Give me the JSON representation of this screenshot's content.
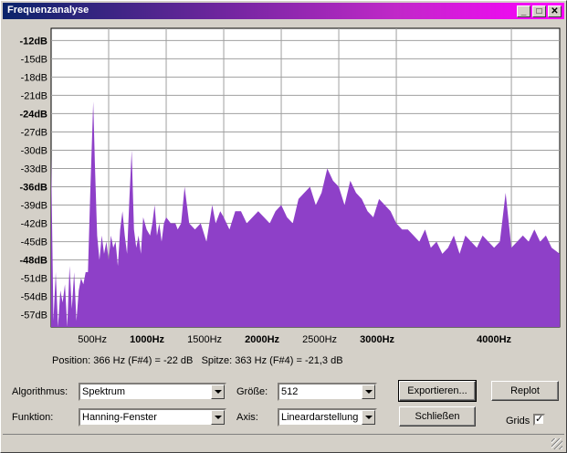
{
  "window": {
    "title": "Frequenzanalyse"
  },
  "titlebar_buttons": {
    "min": "_",
    "max": "□",
    "close": "✕"
  },
  "chart_data": {
    "type": "area",
    "xlabel": "",
    "ylabel": "",
    "xlim": [
      0,
      4420
    ],
    "ylim": [
      -59,
      -10
    ],
    "grid": true,
    "y_ticks": [
      "-12dB",
      "-15dB",
      "-18dB",
      "-21dB",
      "-24dB",
      "-27dB",
      "-30dB",
      "-33dB",
      "-36dB",
      "-39dB",
      "-42dB",
      "-45dB",
      "-48dB",
      "-51dB",
      "-54dB",
      "-57dB"
    ],
    "y_tick_values": [
      -12,
      -15,
      -18,
      -21,
      -24,
      -27,
      -30,
      -33,
      -36,
      -39,
      -42,
      -45,
      -48,
      -51,
      -54,
      -57
    ],
    "y_bold": [
      -12,
      -24,
      -36,
      -48
    ],
    "x_ticks": [
      "500Hz",
      "1000Hz",
      "1500Hz",
      "2000Hz",
      "2500Hz",
      "3000Hz",
      "4000Hz"
    ],
    "x_tick_values": [
      500,
      1000,
      1500,
      2000,
      2500,
      3000,
      4000
    ],
    "x_bold": [
      1000,
      2000,
      3000,
      4000
    ],
    "series": [
      {
        "color": "#8e40c8",
        "x": [
          0,
          20,
          40,
          60,
          80,
          100,
          120,
          140,
          160,
          180,
          200,
          220,
          240,
          260,
          280,
          300,
          320,
          340,
          366,
          380,
          400,
          420,
          440,
          460,
          480,
          500,
          520,
          540,
          560,
          580,
          600,
          620,
          640,
          660,
          680,
          700,
          720,
          740,
          760,
          780,
          800,
          830,
          860,
          880,
          900,
          920,
          940,
          960,
          980,
          1000,
          1040,
          1080,
          1100,
          1130,
          1160,
          1200,
          1250,
          1300,
          1350,
          1400,
          1430,
          1470,
          1500,
          1550,
          1600,
          1650,
          1700,
          1750,
          1800,
          1850,
          1900,
          1950,
          2000,
          2050,
          2100,
          2150,
          2200,
          2250,
          2300,
          2350,
          2400,
          2450,
          2500,
          2550,
          2600,
          2650,
          2700,
          2750,
          2800,
          2850,
          2900,
          2950,
          3000,
          3050,
          3100,
          3150,
          3200,
          3250,
          3300,
          3350,
          3400,
          3450,
          3500,
          3550,
          3600,
          3650,
          3700,
          3750,
          3800,
          3850,
          3900,
          3950,
          4000,
          4050,
          4100,
          4150,
          4200,
          4250,
          4300,
          4350,
          4420
        ],
        "values": [
          -31,
          -58,
          -50,
          -59,
          -53,
          -55,
          -52,
          -59,
          -49,
          -56,
          -50,
          -58,
          -53,
          -51,
          -52,
          -50,
          -50,
          -37,
          -22,
          -32,
          -44,
          -48,
          -44,
          -47,
          -45,
          -48,
          -44,
          -46,
          -45,
          -49,
          -43,
          -40,
          -44,
          -47,
          -38,
          -30,
          -43,
          -46,
          -44,
          -47,
          -41,
          -43,
          -44,
          -42,
          -39,
          -44,
          -42,
          -45,
          -42,
          -41,
          -42,
          -42,
          -43,
          -42,
          -36,
          -42,
          -43,
          -42,
          -45,
          -39,
          -42,
          -40,
          -41,
          -43,
          -40,
          -40,
          -42,
          -41,
          -40,
          -41,
          -42,
          -40,
          -39,
          -41,
          -42,
          -38,
          -37,
          -36,
          -39,
          -37,
          -33,
          -35,
          -36,
          -39,
          -35,
          -37,
          -38,
          -40,
          -41,
          -38,
          -39,
          -40,
          -42,
          -43,
          -43,
          -44,
          -45,
          -43,
          -46,
          -45,
          -47,
          -46,
          -44,
          -47,
          -44,
          -45,
          -46,
          -44,
          -45,
          -46,
          -45,
          -37,
          -46,
          -45,
          -44,
          -45,
          -43,
          -45,
          -44,
          -46,
          -47
        ]
      }
    ]
  },
  "status": {
    "position": "Position: 366 Hz (F#4) = -22 dB",
    "peak": "Spitze: 363 Hz (F#4) = -21,3 dB"
  },
  "controls": {
    "algorithm_label": "Algorithmus:",
    "algorithm_value": "Spektrum",
    "function_label": "Funktion:",
    "function_value": "Hanning-Fenster",
    "size_label": "Größe:",
    "size_value": "512",
    "axis_label": "Axis:",
    "axis_value": "Lineardarstellung",
    "export_button": "Exportieren...",
    "close_button": "Schließen",
    "replot_button": "Replot",
    "grids_label": "Grids",
    "grids_checked": "✓"
  }
}
